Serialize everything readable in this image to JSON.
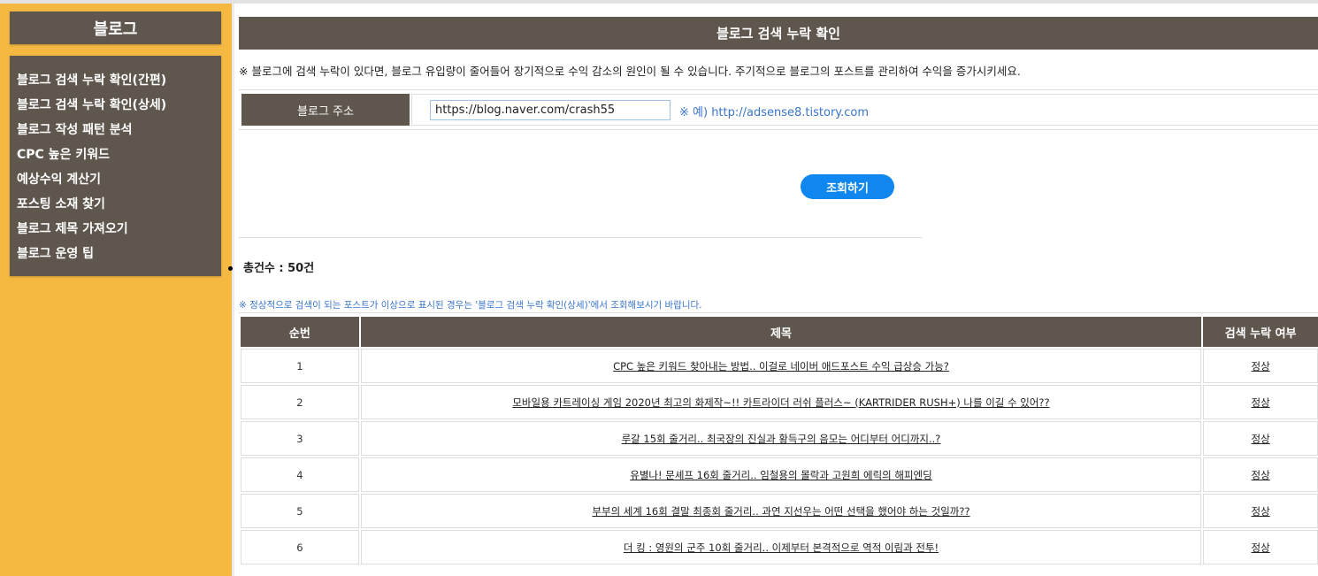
{
  "sidebar": {
    "title": "블로그",
    "items": [
      {
        "label": "블로그 검색 누락 확인(간편)"
      },
      {
        "label": "블로그 검색 누락 확인(상세)"
      },
      {
        "label": "블로그 작성 패턴 분석"
      },
      {
        "label": "CPC 높은 키워드"
      },
      {
        "label": "예상수익 계산기"
      },
      {
        "label": "포스팅 소재 찾기"
      },
      {
        "label": "블로그 제목 가져오기"
      },
      {
        "label": "블로그 운영 팁"
      }
    ]
  },
  "main": {
    "title": "블로그 검색 누락 확인",
    "notice": "※ 블로그에 검색 누락이 있다면, 블로그 유입량이 줄어들어 장기적으로 수익 감소의 원인이 될 수 있습니다. 주기적으로 블로그의 포스트를 관리하여 수익을 증가시키세요.",
    "address_label": "블로그 주소",
    "address_value": "https://blog.naver.com/crash55",
    "address_example": "※ 예) http://adsense8.tistory.com",
    "search_button": "조회하기",
    "total_count": "총건수 : 50건",
    "small_note": "※ 정상적으로 검색이 되는 포스트가 이상으로 표시된 경우는 '블로그 검색 누락 확인(상세)'에서 조회해보시기 바랍니다."
  },
  "table": {
    "headers": [
      "순번",
      "제목",
      "검색 누락 여부"
    ],
    "rows": [
      {
        "no": "1",
        "title": "CPC 높은 키워드 찾아내는 방법.. 이걸로 네이버 애드포스트 수익 급상승 가능?",
        "status": "정상"
      },
      {
        "no": "2",
        "title": "모바일용 카트레이싱 게임 2020년 최고의 화제작~!! 카트라이더 러쉬 플러스~ (KARTRIDER RUSH+) 나를 이길 수 있어??",
        "status": "정상"
      },
      {
        "no": "3",
        "title": "루갈 15회 줄거리.. 최국장의 진실과 황득구의 음모는 어디부터 어디까지..?",
        "status": "정상"
      },
      {
        "no": "4",
        "title": "유별나! 문셰프 16회 줄거리.. 임철용의 몰락과 고원희 에릭의 해피엔딩",
        "status": "정상"
      },
      {
        "no": "5",
        "title": "부부의 세계 16회 결말 최종회 줄거리.. 과연 지선우는 어떤 선택을 했어야 하는 것일까??",
        "status": "정상"
      },
      {
        "no": "6",
        "title": "더 킹 : 영원의 군주 10회 줄거리.. 이제부터 본격적으로 역적 이림과 전투!",
        "status": "정상"
      }
    ]
  }
}
